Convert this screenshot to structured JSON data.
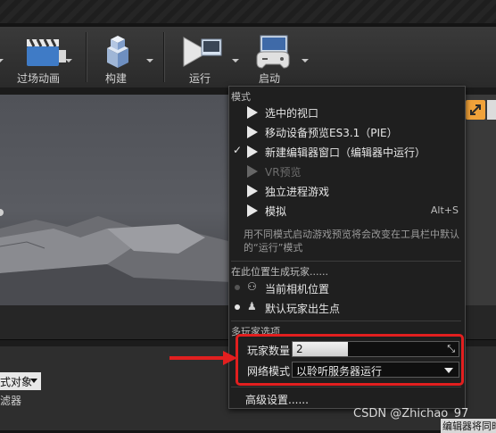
{
  "toolbar": {
    "buttons": [
      {
        "label": "过场动画",
        "icon": "cinematics-clapper-icon"
      },
      {
        "label": "构建",
        "icon": "build-blocks-icon"
      },
      {
        "label": "运行",
        "icon": "play-icon"
      },
      {
        "label": "启动",
        "icon": "launch-gamepad-icon"
      }
    ]
  },
  "menu": {
    "section_modes": "模式",
    "items": [
      {
        "label": "选中的视口",
        "icon": "play-icon"
      },
      {
        "label": "移动设备预览ES3.1（PIE）",
        "icon": "mobile-preview-icon"
      },
      {
        "label": "新建编辑器窗口（编辑器中运行）",
        "icon": "new-window-play-icon",
        "checked": true
      },
      {
        "label": "VR预览",
        "icon": "vr-preview-icon",
        "disabled": true
      },
      {
        "label": "独立进程游戏",
        "icon": "standalone-game-icon"
      },
      {
        "label": "模拟",
        "icon": "simulate-icon",
        "shortcut": "Alt+S"
      }
    ],
    "hint_text": "用不同模式启动游戏预览将会改变在工具栏中默认的“运行”模式",
    "section_spawn": "在此位置生成玩家......",
    "spawn_items": [
      {
        "label": "当前相机位置",
        "icon": "camera-icon"
      },
      {
        "label": "默认玩家出生点",
        "icon": "player-start-icon",
        "selected": true
      }
    ],
    "section_multiplayer": "多玩家选项",
    "player_count_label": "玩家数量",
    "player_count_value": "2",
    "net_mode_label": "网络模式",
    "net_mode_value": "以聆听服务器运行",
    "advanced_label": "高级设置......"
  },
  "left_panel": {
    "button_label": "式对象",
    "filter_label": "滤器"
  },
  "watermark": "CSDN @Zhichao_97",
  "corner_text": "编辑器将同时",
  "colors": {
    "highlight": "#e21f1f",
    "accent": "#f0a23a"
  }
}
